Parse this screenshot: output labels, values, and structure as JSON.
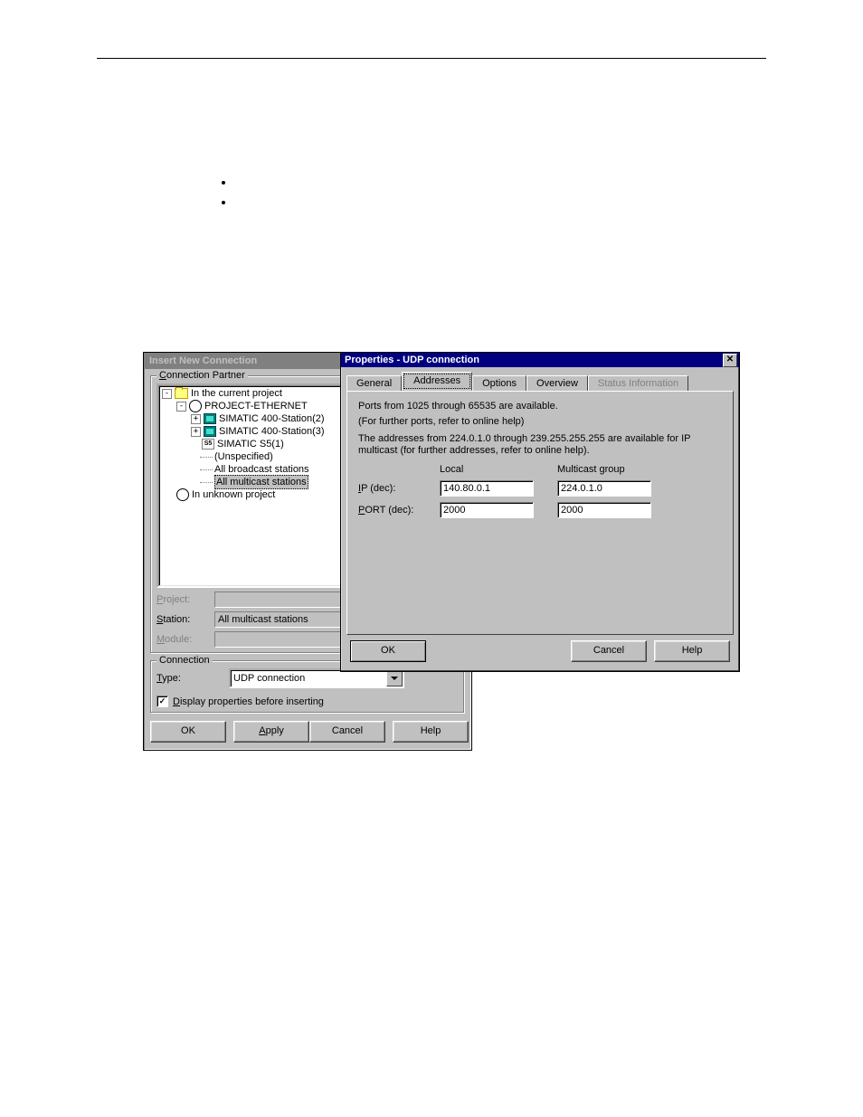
{
  "insert_window": {
    "title": "Insert New Connection",
    "group_partner_label": "Connection Partner",
    "tree": {
      "root": "In the current project",
      "project": "PROJECT-ETHERNET",
      "station2": "SIMATIC 400-Station(2)",
      "station3": "SIMATIC 400-Station(3)",
      "s5": "SIMATIC S5(1)",
      "unspecified": "(Unspecified)",
      "broadcast": "All broadcast stations",
      "multicast": "All multicast stations",
      "unknown": "In unknown project"
    },
    "project_label": "Project:",
    "project_value": "",
    "station_label_pre": "S",
    "station_label_post": "tation:",
    "station_value": "All multicast stations",
    "module_label": "Module:",
    "module_value": "",
    "group_connection_label": "Connection",
    "type_label_pre": "T",
    "type_label_post": "ype:",
    "type_value": "UDP connection",
    "display_prop_label_pre": "D",
    "display_prop_label_post": "isplay properties before inserting",
    "buttons": {
      "ok": "OK",
      "apply_pre": "A",
      "apply_post": "pply",
      "cancel": "Cancel",
      "help": "Help"
    }
  },
  "prop_window": {
    "title": "Properties - UDP connection",
    "tabs": {
      "general": "General",
      "addresses": "Addresses",
      "options": "Options",
      "overview": "Overview",
      "status": "Status Information"
    },
    "text_ports": "Ports from 1025 through 65535 are available.",
    "text_ports2": "(For further ports, refer to online help)",
    "text_ip": "The addresses from 224.0.1.0 through 239.255.255.255 are available for IP multicast (for further addresses, refer to online help).",
    "col_local": "Local",
    "col_multicast": "Multicast group",
    "row_ip_pre": "I",
    "row_ip_post": "P (dec):",
    "row_port_pre": "P",
    "row_port_post": "ORT (dec):",
    "local_ip": "140.80.0.1",
    "local_port": "2000",
    "mc_ip": "224.0.1.0",
    "mc_port": "2000",
    "buttons": {
      "ok": "OK",
      "cancel": "Cancel",
      "help": "Help"
    }
  }
}
